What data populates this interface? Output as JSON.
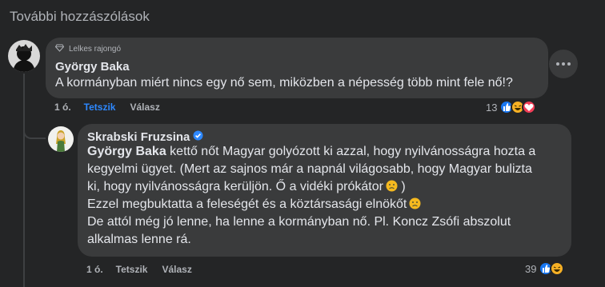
{
  "section": {
    "title": "További hozzászólások"
  },
  "comment1": {
    "badge": "Lelkes rajongó",
    "author": "György Baka",
    "text": "A kormányban miért nincs egy nő sem, miközben a népesség több mint fele nő!?",
    "time": "1 ó.",
    "like_label": "Tetszik",
    "reply_label": "Válasz",
    "reaction_count": "13",
    "reactions": [
      "like-icon",
      "haha-icon",
      "love-icon"
    ]
  },
  "reply1": {
    "author": "Skrabski Fruzsina",
    "verified_icon": "verified-badge-icon",
    "mention": "György Baka",
    "line1_rest": " kettő nőt Magyar golyózott ki azzal, hogy nyilvánosságra hozta a",
    "line2": "kegyelmi ügyet. (Mert az sajnos már a napnál világosabb, hogy Magyar bulizta",
    "line3": "ki, hogy nyilvánosságra kerüljön. Ő a vidéki prókátor",
    "line3_end": " )",
    "line4": "Ezzel megbuktatta a feleségét és a köztársasági elnökőt",
    "line5": "De attól még jó lenne, ha lenne a kormányban nő. Pl. Koncz Zsófi abszolut",
    "line6": "alkalmas lenne rá.",
    "time": "1 ó.",
    "like_label": "Tetszik",
    "reply_label": "Válasz",
    "reaction_count": "39",
    "reactions": [
      "like-icon",
      "haha-icon"
    ]
  },
  "colors": {
    "background": "#242526",
    "bubble": "#3a3b3c",
    "accent": "#2d88ff",
    "secondary_text": "#b0b3b8"
  }
}
